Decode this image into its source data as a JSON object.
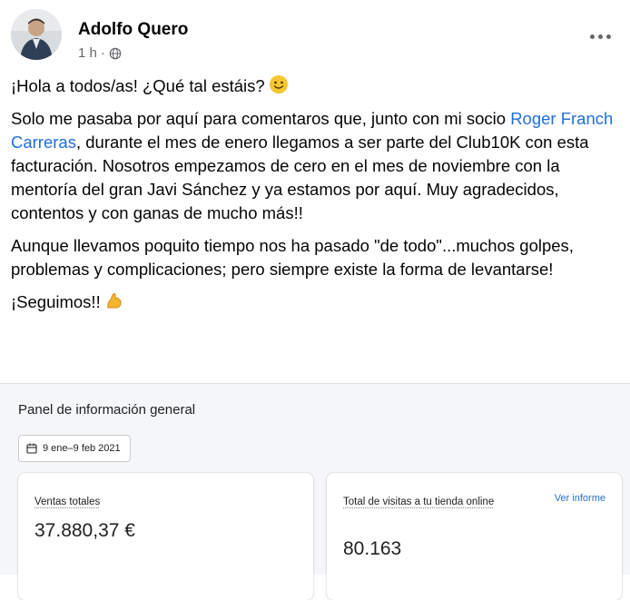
{
  "post": {
    "author": "Adolfo Quero",
    "time": "1 h",
    "separator": "·",
    "paragraphs": {
      "p1": "¡Hola a todos/as! ¿Qué tal estáis?",
      "p2_mention": "Roger Franch Carreras",
      "p2_before": "Solo me pasaba por aquí para comentaros que, junto con mi socio ",
      "p2_after": ", durante el mes de enero llegamos a ser parte del Club10K con esta facturación. Nosotros empezamos de cero en el mes de noviembre con la mentoría del gran Javi Sánchez y ya estamos por aquí. Muy agradecidos, contentos y con ganas de mucho más!!",
      "p3": "Aunque llevamos poquito tiempo nos ha pasado \"de todo\"...muchos golpes, problemas y complicaciones; pero siempre existe la forma de levantarse!",
      "p4": "¡Seguimos!!"
    },
    "icons": {
      "privacy": "globe-icon",
      "more": "more-horizontal-icon",
      "smile": "slightly-smiling-face-icon",
      "flex": "flexed-biceps-icon"
    }
  },
  "dashboard": {
    "title": "Panel de información general",
    "date_range": "9 ene–9 feb 2021",
    "sales": {
      "label": "Ventas totales",
      "value": "37.880,37 €"
    },
    "visits": {
      "label": "Total de visitas a tu tienda online",
      "link": "Ver informe",
      "value": "80.163"
    }
  },
  "colors": {
    "mention": "#216fdb",
    "link": "#2c6ecb",
    "dashboard_bg": "#f4f6f8"
  }
}
